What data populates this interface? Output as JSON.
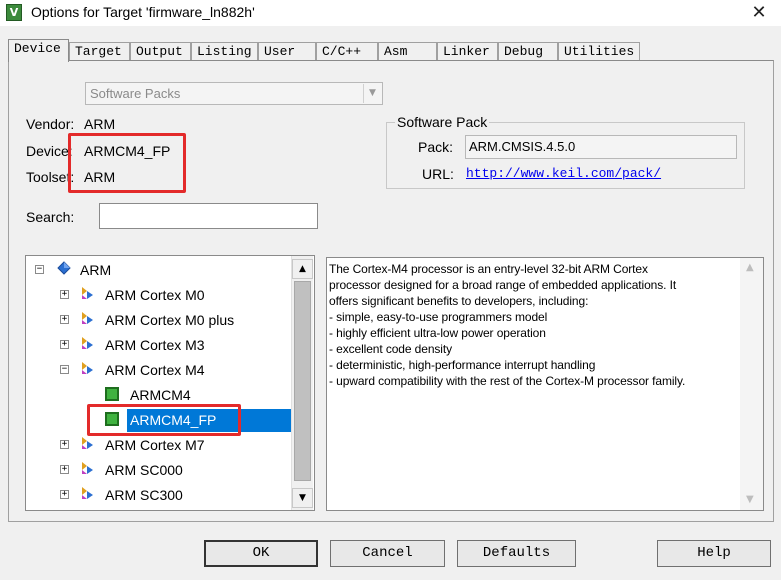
{
  "window": {
    "title": "Options for Target 'firmware_ln882h'",
    "app_icon": "V",
    "close_glyph": "✕"
  },
  "tabs": [
    {
      "label": "Device",
      "active": true
    },
    {
      "label": "Target",
      "active": false
    },
    {
      "label": "Output",
      "active": false
    },
    {
      "label": "Listing",
      "active": false
    },
    {
      "label": "User",
      "active": false
    },
    {
      "label": "C/C++",
      "active": false
    },
    {
      "label": "Asm",
      "active": false
    },
    {
      "label": "Linker",
      "active": false
    },
    {
      "label": "Debug",
      "active": false
    },
    {
      "label": "Utilities",
      "active": false
    }
  ],
  "device": {
    "source_select": "Software Packs",
    "vendor_label": "Vendor:",
    "vendor_value": "ARM",
    "device_label": "Device:",
    "device_value": "ARMCM4_FP",
    "toolset_label": "Toolset:",
    "toolset_value": "ARM",
    "search_label": "Search:",
    "search_value": ""
  },
  "software_pack": {
    "title": "Software Pack",
    "pack_label": "Pack:",
    "pack_value": "ARM.CMSIS.4.5.0",
    "url_label": "URL:",
    "url_value": "http://www.keil.com/pack/"
  },
  "tree": {
    "items": [
      {
        "label": "ARM",
        "expander": "−",
        "icon": "vendor-diamond-icon"
      },
      {
        "label": "ARM Cortex M0",
        "expander": "+",
        "icon": "family-icon"
      },
      {
        "label": "ARM Cortex M0 plus",
        "expander": "+",
        "icon": "family-icon"
      },
      {
        "label": "ARM Cortex M3",
        "expander": "+",
        "icon": "family-icon"
      },
      {
        "label": "ARM Cortex M4",
        "expander": "−",
        "icon": "family-icon"
      },
      {
        "label": "ARMCM4",
        "expander": "",
        "icon": "chip-icon"
      },
      {
        "label": "ARMCM4_FP",
        "expander": "",
        "icon": "chip-icon",
        "selected": true
      },
      {
        "label": "ARM Cortex M7",
        "expander": "+",
        "icon": "family-icon"
      },
      {
        "label": "ARM SC000",
        "expander": "+",
        "icon": "family-icon"
      },
      {
        "label": "ARM SC300",
        "expander": "+",
        "icon": "family-icon"
      }
    ]
  },
  "description": {
    "lines": [
      "The Cortex-M4 processor is an entry-level 32-bit ARM Cortex",
      "processor designed for a broad range of embedded applications. It",
      "offers significant benefits to developers, including:",
      "- simple, easy-to-use programmers model",
      "- highly efficient ultra-low power operation",
      "- excellent code density",
      "- deterministic, high-performance interrupt handling",
      "- upward compatibility with the rest of the Cortex-M processor family."
    ]
  },
  "buttons": {
    "ok": "OK",
    "cancel": "Cancel",
    "defaults": "Defaults",
    "help": "Help"
  },
  "colors": {
    "highlight_box": "#e32a2a",
    "selection": "#0078d7",
    "link": "#0000ee"
  }
}
